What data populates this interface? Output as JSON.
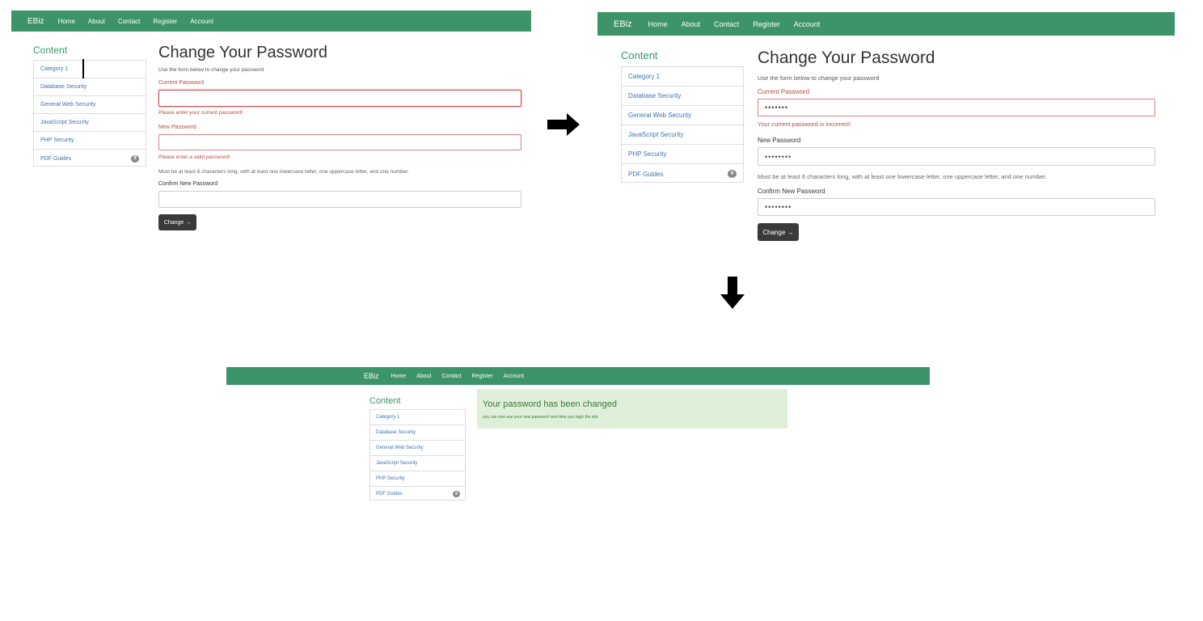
{
  "navbar": {
    "brand": "EBiz",
    "links": [
      "Home",
      "About",
      "Contact",
      "Register",
      "Account"
    ]
  },
  "sidebar": {
    "title": "Content",
    "items": [
      {
        "label": "Category 1"
      },
      {
        "label": "Database Security"
      },
      {
        "label": "General Web Security"
      },
      {
        "label": "JavaScript Security"
      },
      {
        "label": "PHP Security"
      },
      {
        "label": "PDF Guides",
        "badge": "9"
      }
    ]
  },
  "form": {
    "title": "Change Your Password",
    "description": "Use the form below to change your password",
    "current_label": "Current Password",
    "new_label": "New Password",
    "confirm_label": "Confirm New Password",
    "hint": "Must be at least 6 characters long, with at least one lowercase letter, one uppercase letter, and one number.",
    "button_label": "Change →"
  },
  "step1": {
    "current_error": "Please enter your current password!",
    "new_error": "Please enter a valid password!",
    "current_value": "",
    "new_value": "",
    "confirm_value": ""
  },
  "step2": {
    "current_error": "Your current password is incorrect!",
    "current_value": "•••••••",
    "new_value": "••••••••",
    "confirm_value": "••••••••"
  },
  "step3": {
    "success_title": "Your password has been changed",
    "success_text": "you can now use your new password next time you login the site"
  },
  "colors": {
    "navbar": "#3c9468",
    "link": "#3c72b4",
    "error": "#b94a48",
    "success_bg": "#dff0d8",
    "success_text": "#3c763d",
    "button": "#3a3a3a"
  },
  "icons": {
    "flow_right": "arrow-right-icon",
    "flow_down": "arrow-down-icon"
  }
}
